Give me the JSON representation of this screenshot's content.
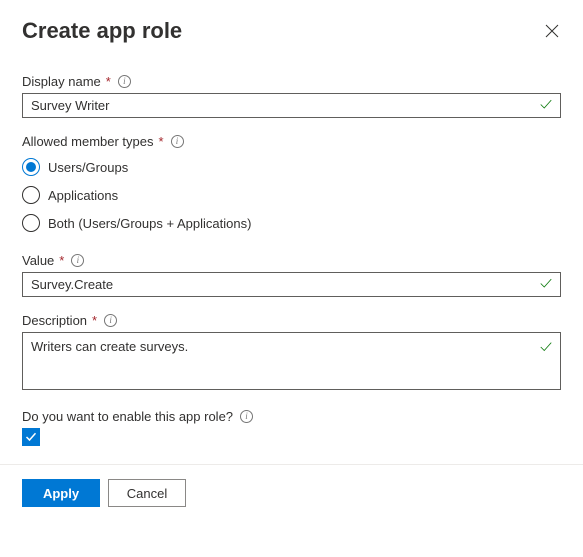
{
  "header": {
    "title": "Create app role"
  },
  "fields": {
    "displayName": {
      "label": "Display name",
      "value": "Survey Writer"
    },
    "memberTypes": {
      "label": "Allowed member types",
      "options": [
        {
          "label": "Users/Groups",
          "selected": true
        },
        {
          "label": "Applications",
          "selected": false
        },
        {
          "label": "Both (Users/Groups + Applications)",
          "selected": false
        }
      ]
    },
    "value": {
      "label": "Value",
      "value": "Survey.Create"
    },
    "description": {
      "label": "Description",
      "value": "Writers can create surveys."
    },
    "enable": {
      "label": "Do you want to enable this app role?",
      "checked": true
    }
  },
  "footer": {
    "apply": "Apply",
    "cancel": "Cancel"
  }
}
